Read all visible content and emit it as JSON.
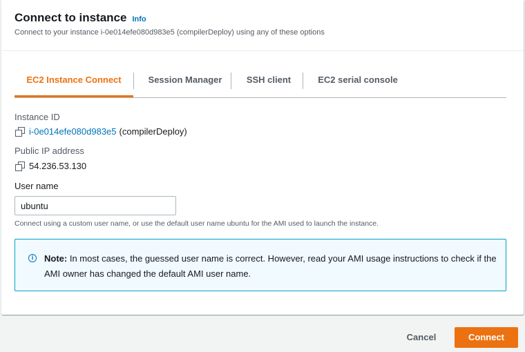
{
  "header": {
    "title": "Connect to instance",
    "info": "Info",
    "subtitle": "Connect to your instance i-0e014efe080d983e5 (compilerDeploy) using any of these options"
  },
  "tabs": [
    {
      "label": "EC2 Instance Connect",
      "active": true
    },
    {
      "label": "Session Manager",
      "active": false
    },
    {
      "label": "SSH client",
      "active": false
    },
    {
      "label": "EC2 serial console",
      "active": false
    }
  ],
  "instance": {
    "id_label": "Instance ID",
    "id_value": "i-0e014efe080d983e5",
    "id_name": "(compilerDeploy)",
    "ip_label": "Public IP address",
    "ip_value": "54.236.53.130"
  },
  "username": {
    "label": "User name",
    "value": "ubuntu",
    "hint": "Connect using a custom user name, or use the default user name ubuntu for the AMI used to launch the instance."
  },
  "note": {
    "prefix": "Note:",
    "text": " In most cases, the guessed user name is correct. However, read your AMI usage instructions to check if the AMI owner has changed the default AMI user name."
  },
  "footer": {
    "cancel": "Cancel",
    "connect": "Connect"
  },
  "colors": {
    "accent": "#ec7211",
    "link": "#0073bb",
    "note_border": "#00a1c9",
    "note_bg": "#f1faff"
  }
}
